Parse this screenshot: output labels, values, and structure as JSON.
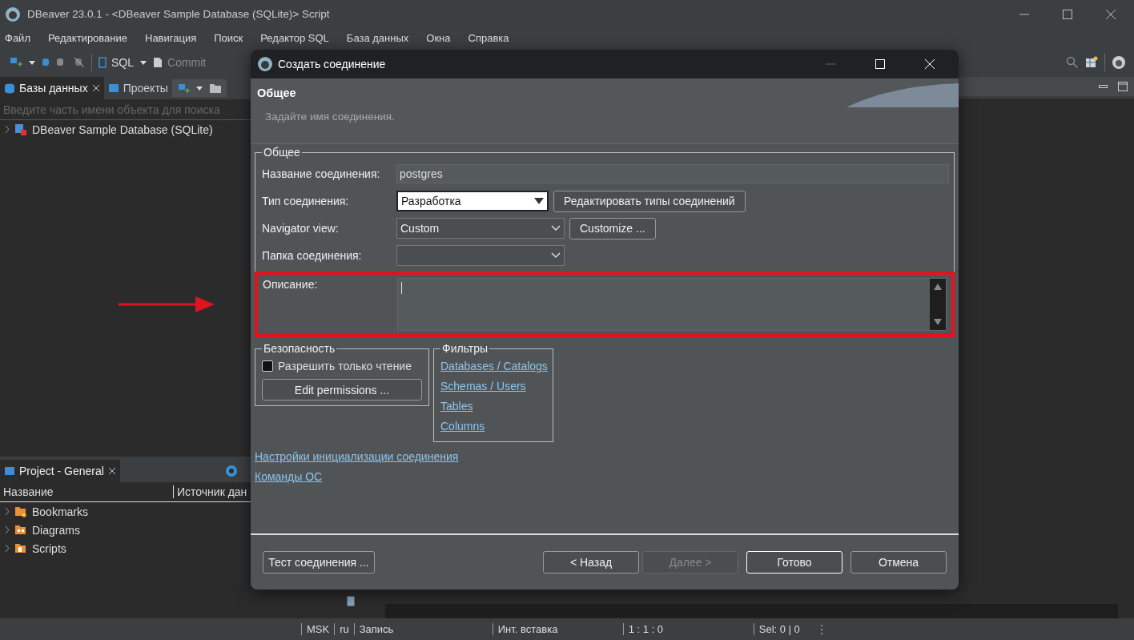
{
  "window": {
    "title": "DBeaver 23.0.1 - <DBeaver Sample Database (SQLite)> Script"
  },
  "menu": [
    "Файл",
    "Редактирование",
    "Навигация",
    "Поиск",
    "Редактор SQL",
    "База данных",
    "Окна",
    "Справка"
  ],
  "toolbar": {
    "sql": "SQL",
    "commit": "Commit"
  },
  "db_panel": {
    "tabs": [
      {
        "label": "Базы данных",
        "selected": true
      },
      {
        "label": "Проекты",
        "selected": false
      }
    ],
    "search": {
      "placeholder": "Введите часть имени объекта для поиска"
    },
    "tree": [
      {
        "label": "DBeaver Sample Database (SQLite)",
        "expanded": false
      }
    ]
  },
  "project_panel": {
    "title": "Project - General",
    "columns": [
      "Название",
      "Источник дан"
    ],
    "items": [
      {
        "label": "Bookmarks",
        "kind": "bookmarks"
      },
      {
        "label": "Diagrams",
        "kind": "diagrams"
      },
      {
        "label": "Scripts",
        "kind": "scripts"
      }
    ]
  },
  "status_bar": [
    "MSK",
    "ru",
    "Запись",
    "Инт. вставка",
    "1 : 1 : 0",
    "Sel: 0 | 0"
  ],
  "dialog": {
    "title": "Создать соединение",
    "header": "Общее",
    "subtitle": "Задайте имя соединения.",
    "general": {
      "legend": "Общее",
      "fields": [
        {
          "kind": "text",
          "label": "Название соединения:",
          "value": "postgres"
        },
        {
          "kind": "type_combo",
          "label": "Тип соединения:",
          "value": "Разработка",
          "button": "Редактировать типы соединений"
        },
        {
          "kind": "combo",
          "label": "Navigator view:",
          "value": "Custom",
          "button": "Customize ..."
        },
        {
          "kind": "combo",
          "label": "Папка соединения:"
        }
      ]
    },
    "description": {
      "label": "Описание:",
      "highlighted": true
    },
    "security": {
      "legend": "Безопасность",
      "checkbox": {
        "label": "Разрешить только чтение",
        "checked": false
      },
      "button": "Edit permissions ..."
    },
    "filters": {
      "legend": "Фильтры",
      "links": [
        "Databases / Catalogs",
        "Schemas / Users",
        "Tables",
        "Columns"
      ]
    },
    "links": [
      "Настройки инициализации соединения",
      "Команды ОС"
    ],
    "buttons": [
      {
        "label": "Тест соединения ...",
        "default": false,
        "disabled": false
      },
      {
        "label": "< Назад",
        "default": false,
        "disabled": false
      },
      {
        "label": "Далее >",
        "default": false,
        "disabled": true
      },
      {
        "label": "Готово",
        "default": true,
        "disabled": false
      },
      {
        "label": "Отмена",
        "default": false,
        "disabled": false
      }
    ]
  }
}
